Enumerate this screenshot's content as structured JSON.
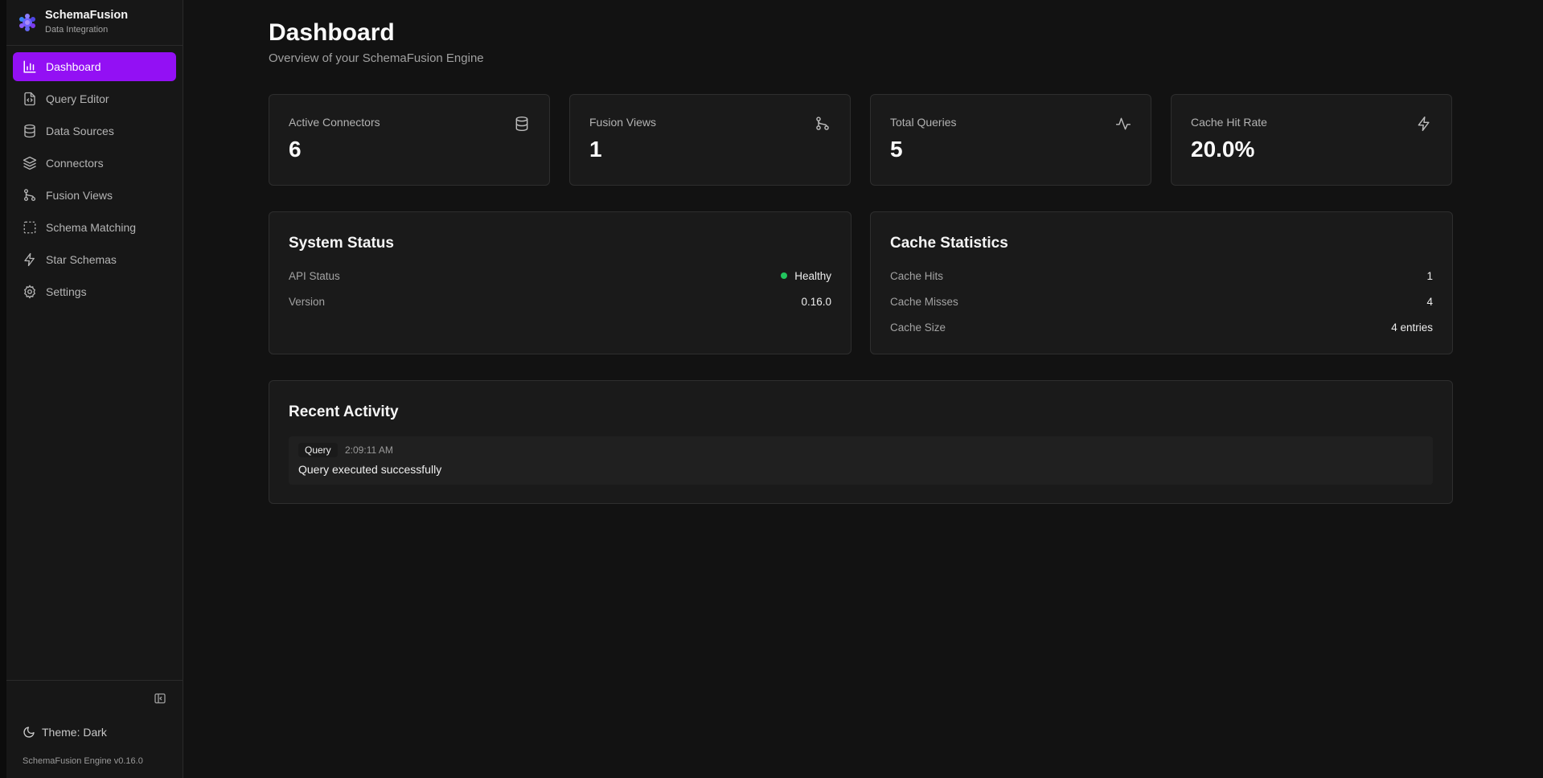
{
  "app": {
    "name": "SchemaFusion",
    "subtitle": "Data Integration",
    "logo_color": "#7c4dff"
  },
  "colors": {
    "accent": "#9310f4",
    "background": "#121212",
    "card": "#1a1a1a",
    "healthy": "#22c55e"
  },
  "sidebar": {
    "items": [
      {
        "label": "Dashboard",
        "icon": "bar-chart-icon",
        "active": true
      },
      {
        "label": "Query Editor",
        "icon": "file-code-icon"
      },
      {
        "label": "Data Sources",
        "icon": "database-icon"
      },
      {
        "label": "Connectors",
        "icon": "layers-icon"
      },
      {
        "label": "Fusion Views",
        "icon": "git-branch-icon"
      },
      {
        "label": "Schema Matching",
        "icon": "dashed-square-icon"
      },
      {
        "label": "Star Schemas",
        "icon": "lightning-icon"
      },
      {
        "label": "Settings",
        "icon": "gear-icon"
      }
    ],
    "collapse_icon": "panel-left-icon",
    "theme_label": "Theme: Dark",
    "theme_icon": "moon-icon",
    "version_label": "SchemaFusion Engine v0.16.0"
  },
  "header": {
    "title": "Dashboard",
    "subtitle": "Overview of your SchemaFusion Engine"
  },
  "stats": [
    {
      "label": "Active Connectors",
      "value": "6",
      "icon": "database-icon"
    },
    {
      "label": "Fusion Views",
      "value": "1",
      "icon": "git-branch-icon"
    },
    {
      "label": "Total Queries",
      "value": "5",
      "icon": "activity-icon"
    },
    {
      "label": "Cache Hit Rate",
      "value": "20.0%",
      "icon": "lightning-icon"
    }
  ],
  "system_status": {
    "title": "System Status",
    "rows": [
      {
        "key": "API Status",
        "value": "Healthy"
      },
      {
        "key": "Version",
        "value": "0.16.0"
      }
    ]
  },
  "cache_statistics": {
    "title": "Cache Statistics",
    "rows": [
      {
        "key": "Cache Hits",
        "value": "1"
      },
      {
        "key": "Cache Misses",
        "value": "4"
      },
      {
        "key": "Cache Size",
        "value": "4 entries"
      }
    ]
  },
  "recent_activity": {
    "title": "Recent Activity",
    "items": [
      {
        "type": "Query",
        "time": "2:09:11 AM",
        "message": "Query executed successfully"
      }
    ]
  }
}
